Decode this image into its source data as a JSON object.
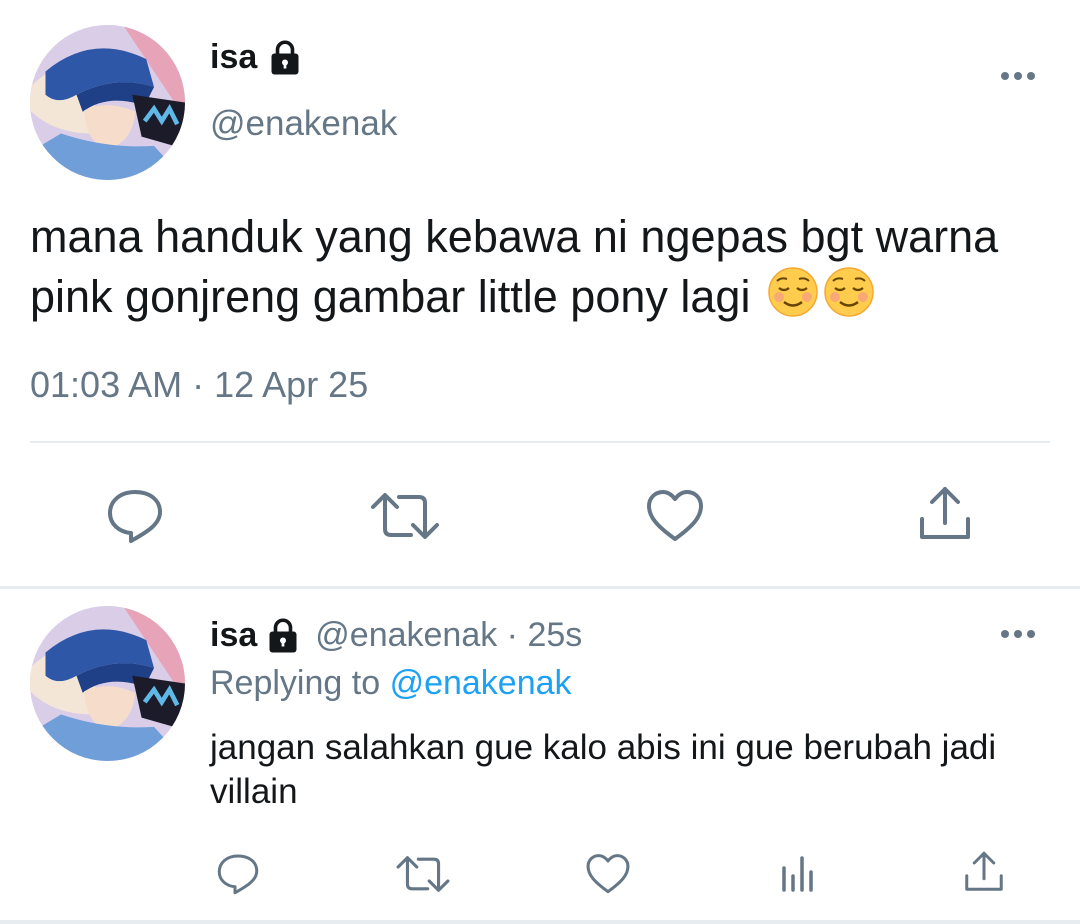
{
  "main_tweet": {
    "display_name": "isa",
    "handle": "@enakenak",
    "text": "mana handuk yang kebawa ni ngepas bgt warna pink gonjreng gambar little pony lagi",
    "emojis": [
      "relieved-smile-emoji",
      "relieved-smile-emoji"
    ],
    "timestamp": "01:03 AM · 12 Apr 25",
    "actions": [
      "reply-icon",
      "retweet-icon",
      "like-icon",
      "share-icon"
    ]
  },
  "reply_tweet": {
    "display_name": "isa",
    "meta": "@enakenak · 25s",
    "replying_prefix": "Replying to",
    "replying_mention": "@enakenak",
    "text": "jangan salahkan gue kalo abis ini gue berubah jadi villain",
    "actions": [
      "reply-icon",
      "retweet-icon",
      "like-icon",
      "analytics-icon",
      "share-icon"
    ]
  },
  "colors": {
    "text_primary": "#14171a",
    "text_secondary": "#657786",
    "link": "#1da1f2",
    "icon": "#657786",
    "divider": "#e6ecf0"
  }
}
